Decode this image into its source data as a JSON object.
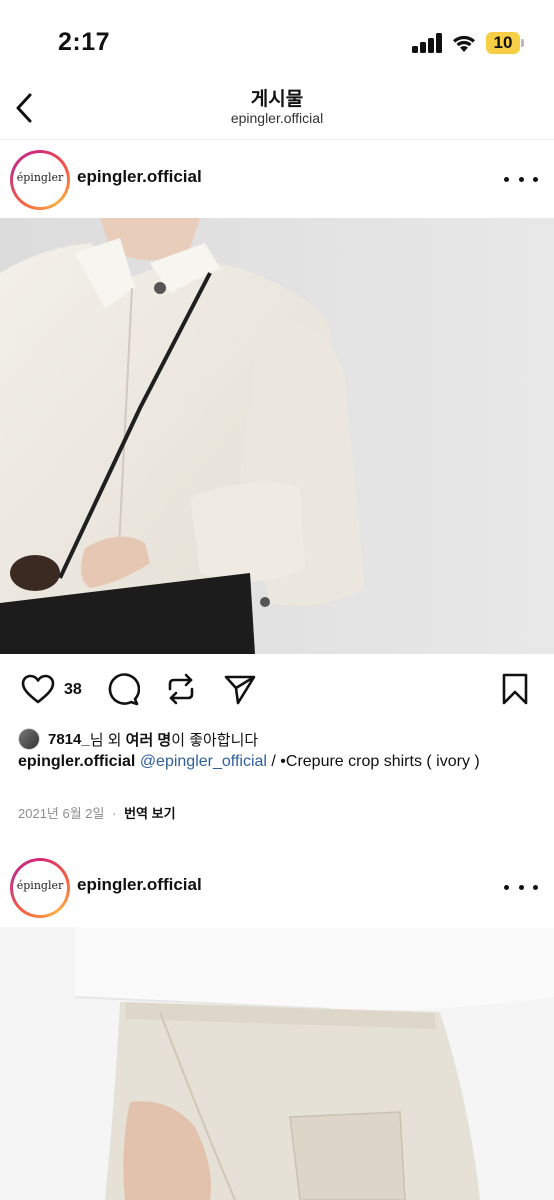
{
  "status_bar": {
    "time": "2:17",
    "battery": "10",
    "battery_color": "#f7cf46"
  },
  "nav": {
    "title": "게시물",
    "subtitle": "epingler.official",
    "back_icon": "chevron-left-icon"
  },
  "posts": [
    {
      "avatar_text": "épingler",
      "username": "epingler.official",
      "likes": "38",
      "liked_by": {
        "user": "7814_",
        "text_before": "님 외 ",
        "bold": "여러 명",
        "text_after": "이 좋아합니다"
      },
      "caption": {
        "username": "epingler.official",
        "mention": "@epingler_official",
        "text": " / •Crepure crop shirts ( ivory )"
      },
      "date": "2021년 6월 2일",
      "separator": "·",
      "translate": "번역 보기"
    },
    {
      "avatar_text": "épingler",
      "username": "epingler.official"
    }
  ],
  "colors": {
    "mention": "#2f5f9e",
    "meta": "#8e8e8e",
    "story_ring": [
      "#d52a77",
      "#f56040",
      "#fcaf45"
    ]
  }
}
